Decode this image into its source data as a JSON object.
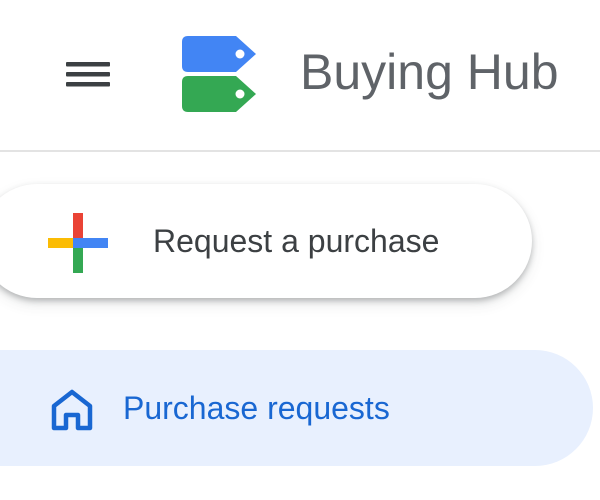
{
  "header": {
    "app_title": "Buying Hub",
    "menu_icon": "hamburger-menu-icon",
    "logo_icon": "price-tags-logo"
  },
  "actions": {
    "request_label": "Request a purchase",
    "request_icon": "multicolor-plus-icon"
  },
  "nav": {
    "items": [
      {
        "label": "Purchase requests",
        "icon": "home-icon",
        "active": true
      }
    ]
  },
  "colors": {
    "nav_active_bg": "#e8f0fe",
    "nav_active_text": "#1967d2",
    "logo_blue": "#4285f4",
    "logo_green": "#34a853",
    "plus_red": "#ea4335",
    "plus_blue": "#4285f4",
    "plus_yellow": "#fbbc04",
    "plus_green": "#34a853"
  }
}
